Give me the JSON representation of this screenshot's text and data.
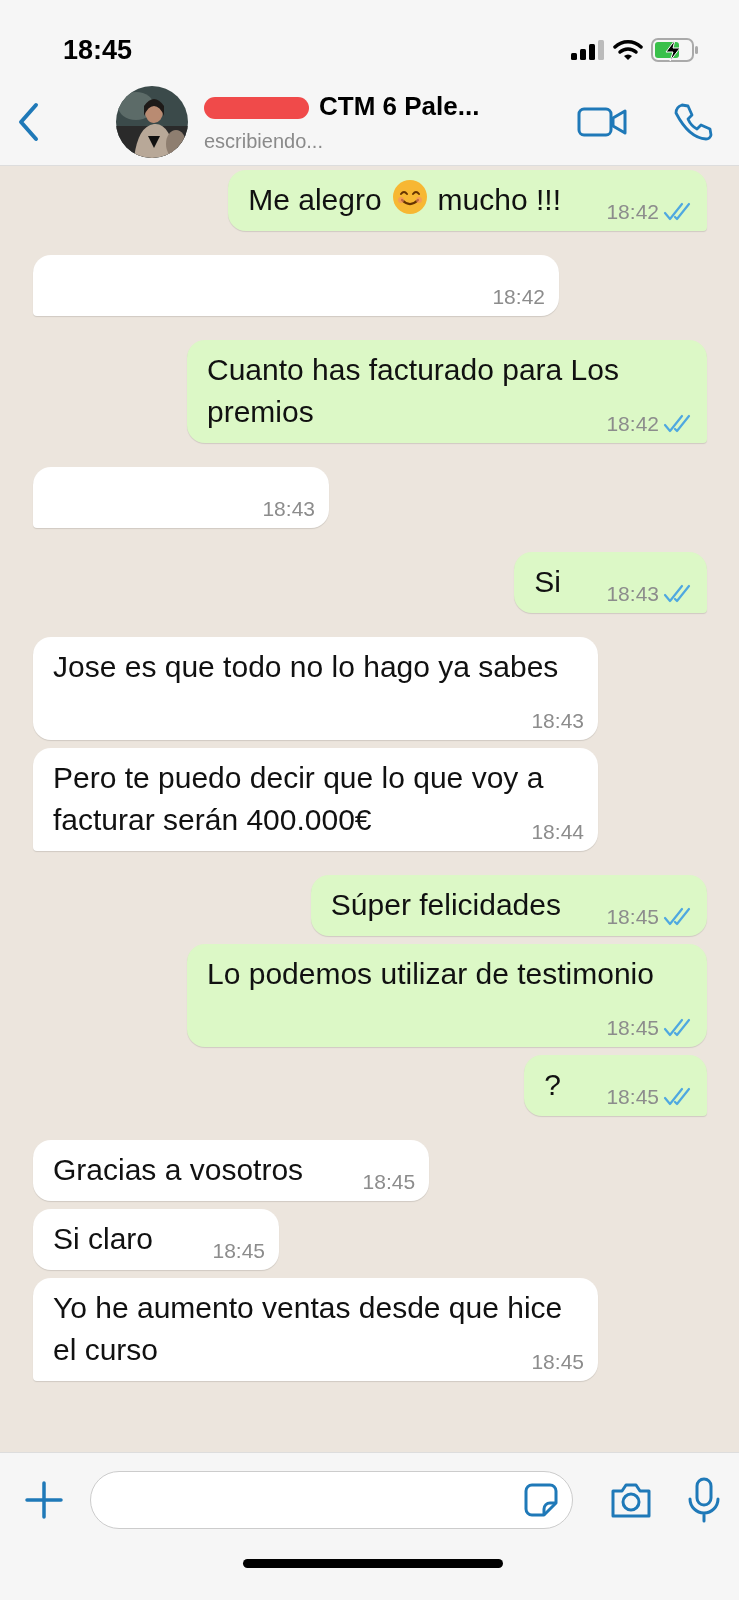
{
  "status_bar": {
    "time": "18:45",
    "charging": true
  },
  "header": {
    "name": "CTM  6  Pale...",
    "name_redacted": true,
    "status": "escribiendo..."
  },
  "messages": [
    {
      "outgoing": true,
      "kind": "emoji_text",
      "before": "Me alegro",
      "after": "mucho !!!",
      "time": "18:42",
      "read": true,
      "tail": true
    },
    {
      "outgoing": false,
      "kind": "erased",
      "time": "18:42",
      "tail": true
    },
    {
      "outgoing": true,
      "kind": "text",
      "text": "Cuanto has facturado para Los premios",
      "time": "18:42",
      "read": true,
      "tail": true
    },
    {
      "outgoing": false,
      "kind": "erased",
      "time": "18:43",
      "tail": true
    },
    {
      "outgoing": true,
      "kind": "text",
      "text": "Si",
      "time": "18:43",
      "read": true,
      "tail": true
    },
    {
      "outgoing": false,
      "kind": "text",
      "text": "Jose es que todo no lo hago ya sabes",
      "time": "18:43",
      "tail": false
    },
    {
      "outgoing": false,
      "kind": "text",
      "text": "Pero te puedo decir que lo que voy a facturar serán 400.000€",
      "time": "18:44",
      "tail": true
    },
    {
      "outgoing": true,
      "kind": "text",
      "text": "Súper felicidades",
      "time": "18:45",
      "read": true,
      "tail": false
    },
    {
      "outgoing": true,
      "kind": "text",
      "text": "Lo podemos utilizar de testimonio",
      "time": "18:45",
      "read": true,
      "tail": false
    },
    {
      "outgoing": true,
      "kind": "text",
      "text": "?",
      "time": "18:45",
      "read": true,
      "tail": true
    },
    {
      "outgoing": false,
      "kind": "text",
      "text": "Gracias a vosotros",
      "time": "18:45",
      "tail": false
    },
    {
      "outgoing": false,
      "kind": "text",
      "text": "Si claro",
      "time": "18:45",
      "tail": false
    },
    {
      "outgoing": false,
      "kind": "text",
      "text": "Yo he aumento ventas desde que hice el curso",
      "time": "18:45",
      "tail": true
    }
  ]
}
